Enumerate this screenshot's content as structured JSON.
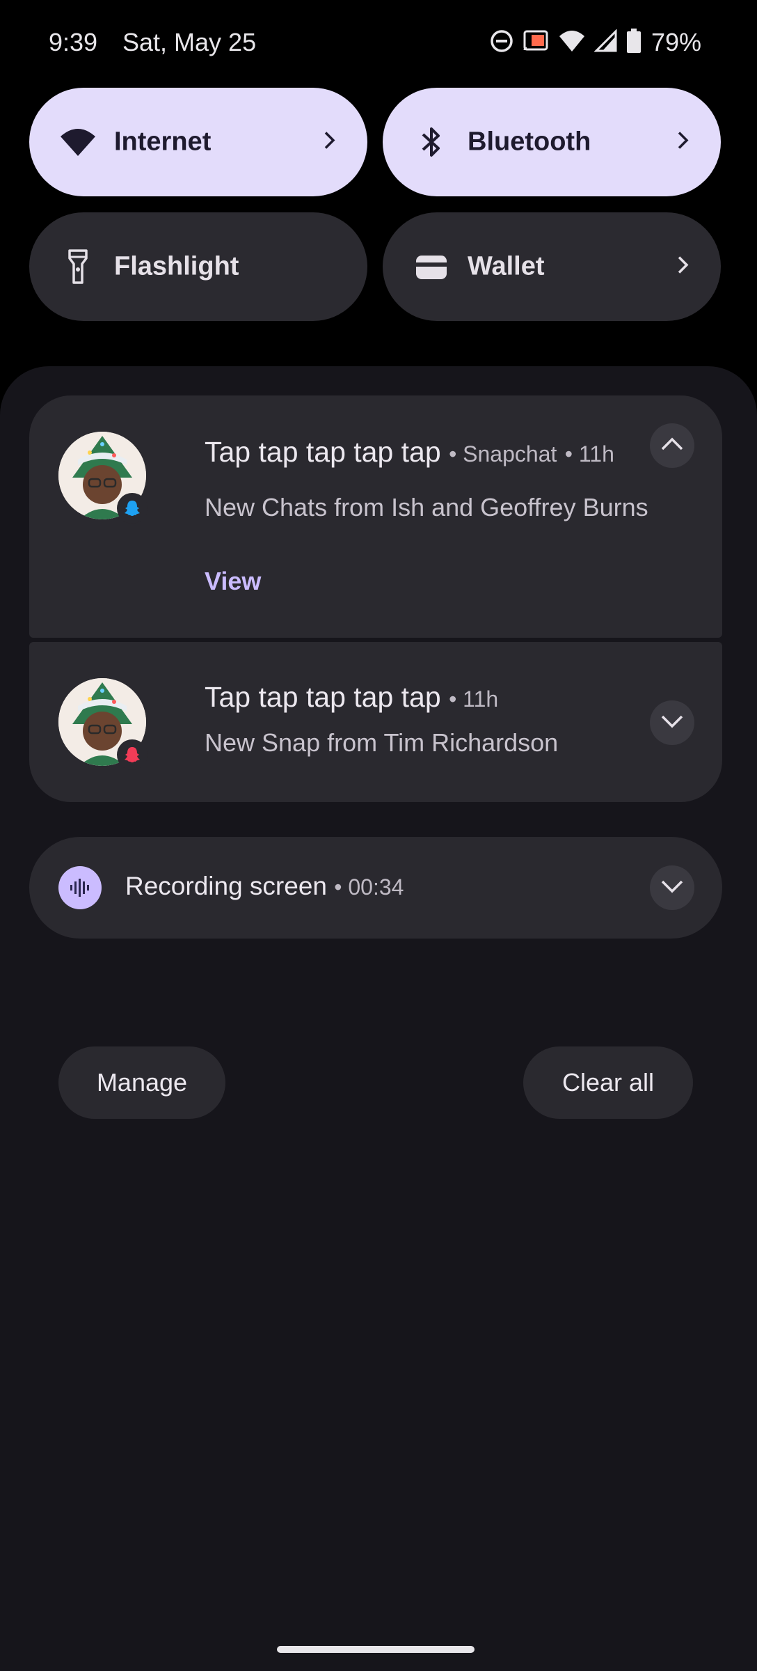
{
  "status_bar": {
    "time": "9:39",
    "date": "Sat, May 25",
    "battery": "79%",
    "icons": [
      "dnd-icon",
      "cast-icon",
      "wifi-icon",
      "signal-icon",
      "battery-icon"
    ]
  },
  "quick_settings": {
    "tiles": [
      {
        "label": "Internet",
        "state": "on",
        "icon": "wifi-icon",
        "has_chevron": true
      },
      {
        "label": "Bluetooth",
        "state": "on",
        "icon": "bluetooth-icon",
        "has_chevron": true
      },
      {
        "label": "Flashlight",
        "state": "off",
        "icon": "flashlight-icon",
        "has_chevron": false
      },
      {
        "label": "Wallet",
        "state": "off",
        "icon": "wallet-icon",
        "has_chevron": true
      }
    ]
  },
  "notifications": [
    {
      "title": "Tap tap tap tap tap",
      "app": "Snapchat",
      "time": "11h",
      "text": "New Chats from Ish and Geoffrey Burns",
      "action": "View",
      "expanded": true,
      "badge_color": "#1ea1f2"
    },
    {
      "title": "Tap tap tap tap tap",
      "time": "11h",
      "text": "New Snap from Tim Richardson",
      "expanded": false,
      "badge_color": "#f23c57"
    }
  ],
  "recording": {
    "title": "Recording screen",
    "elapsed": "00:34"
  },
  "footer": {
    "manage": "Manage",
    "clear_all": "Clear all"
  },
  "colors": {
    "tile_on": "#e3dcfb",
    "tile_off": "#2b2a30",
    "accent": "#cbbcff",
    "panel": "#16151b",
    "card": "#2a292f"
  }
}
